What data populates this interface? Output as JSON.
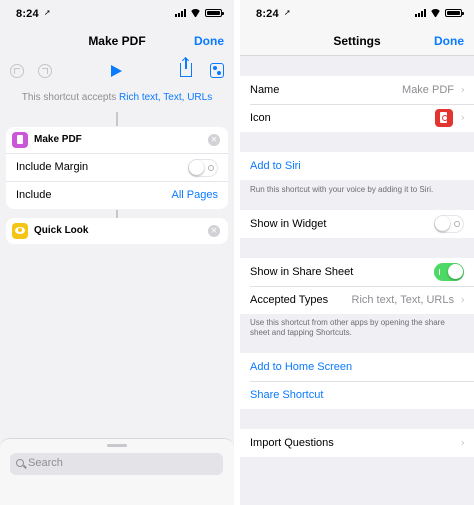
{
  "left": {
    "status": {
      "time": "8:24",
      "location_glyph": "➚"
    },
    "nav": {
      "title": "Make PDF",
      "done": "Done"
    },
    "accepts": {
      "prefix": "This shortcut accepts",
      "types": "Rich text, Text, URLs"
    },
    "actions": [
      {
        "title": "Make PDF",
        "icon": "document-icon",
        "rows": [
          {
            "label": "Include Margin",
            "control": "switch",
            "on": false
          },
          {
            "label": "Include",
            "value": "All Pages"
          }
        ]
      },
      {
        "title": "Quick Look",
        "icon": "eye-icon"
      }
    ],
    "search_placeholder": "Search"
  },
  "right": {
    "status": {
      "time": "8:24",
      "location_glyph": "➚"
    },
    "nav": {
      "title": "Settings",
      "done": "Done"
    },
    "name": {
      "label": "Name",
      "value": "Make PDF"
    },
    "icon_row": {
      "label": "Icon"
    },
    "add_to_siri": "Add to Siri",
    "siri_note": "Run this shortcut with your voice by adding it to Siri.",
    "show_in_widget": {
      "label": "Show in Widget",
      "on": false
    },
    "show_in_share_sheet": {
      "label": "Show in Share Sheet",
      "on": true
    },
    "accepted_types": {
      "label": "Accepted Types",
      "value": "Rich text, Text, URLs"
    },
    "share_note": "Use this shortcut from other apps by opening the share sheet and tapping Shortcuts.",
    "add_to_home": "Add to Home Screen",
    "share_shortcut": "Share Shortcut",
    "import_questions": "Import Questions"
  },
  "colors": {
    "accent": "#0a7aff",
    "switch_on": "#4cd964",
    "pdf_action": "#c957d8",
    "quicklook": "#f5c515",
    "pdf_app": "#e3342f"
  }
}
